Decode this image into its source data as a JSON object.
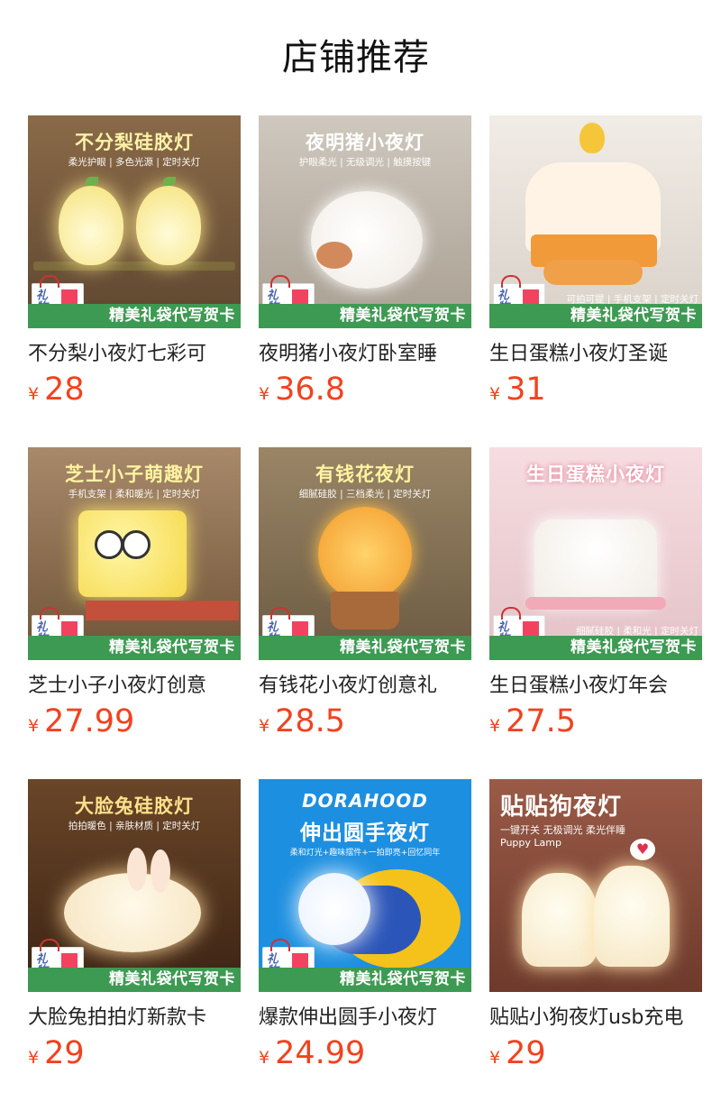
{
  "page": {
    "title": "店铺推荐"
  },
  "banner_text": "精美礼袋代写贺卡",
  "gift_bag_text": "礼物",
  "currency": "¥",
  "products": [
    {
      "name": "不分梨小夜灯七彩可",
      "price": "28",
      "image": {
        "headline": "不分梨硅胶灯",
        "sub": "柔光护眼 | 多色光源 | 定时关灯",
        "bg": "#7a5a38",
        "headline_color": "#fff2a8"
      }
    },
    {
      "name": "夜明猪小夜灯卧室睡",
      "price": "36.8",
      "image": {
        "headline": "夜明猪小夜灯",
        "sub": "护眼柔光 | 无级调光 | 触摸按键",
        "bg": "#c9c2b8",
        "headline_color": "#ffffff"
      }
    },
    {
      "name": "生日蛋糕小夜灯圣诞",
      "price": "31",
      "image": {
        "headline": "",
        "sub": "可拍可提 | 手机支架 | 定时关灯",
        "bg": "#e9e3dc",
        "headline_color": "#ffffff"
      }
    },
    {
      "name": "芝士小子小夜灯创意",
      "price": "27.99",
      "image": {
        "headline": "芝士小子萌趣灯",
        "sub": "手机支架 | 柔和暖光 | 定时关灯",
        "bg": "#9c7c5b",
        "headline_color": "#fff3a0"
      }
    },
    {
      "name": "有钱花小夜灯创意礼",
      "price": "28.5",
      "image": {
        "headline": "有钱花夜灯",
        "sub": "细腻硅胶 | 三档柔光 | 定时关灯",
        "bg": "#8a7558",
        "headline_color": "#fff3a0"
      }
    },
    {
      "name": "生日蛋糕小夜灯年会",
      "price": "27.5",
      "image": {
        "headline": "生日蛋糕小夜灯",
        "sub": "细腻硅胶 | 柔和光 | 定时关灯",
        "bg": "#f3d3d8",
        "headline_color": "#ffffff"
      }
    },
    {
      "name": "大脸兔拍拍灯新款卡",
      "price": "29",
      "image": {
        "headline": "大脸兔硅胶灯",
        "sub": "拍拍暖色 | 亲肤材质 | 定时关灯",
        "bg": "#5b3a22",
        "headline_color": "#ffe08a"
      }
    },
    {
      "name": "爆款伸出圆手小夜灯",
      "price": "24.99",
      "image": {
        "headline": "伸出圆手夜灯",
        "sub": "柔和灯光+趣味摆件+一拍即亮+回忆同年",
        "bg": "#1d8fe0",
        "headline_color": "#ffffff",
        "brand": "DORAHOOD"
      }
    },
    {
      "name": "贴贴小狗夜灯usb充电",
      "price": "29",
      "image": {
        "headline": "贴贴狗夜灯",
        "sub": "一键开关 无极调光 柔光伴睡",
        "bg": "#8a4f3e",
        "headline_color": "#ffffff",
        "tagline": "Puppy Lamp"
      }
    }
  ]
}
